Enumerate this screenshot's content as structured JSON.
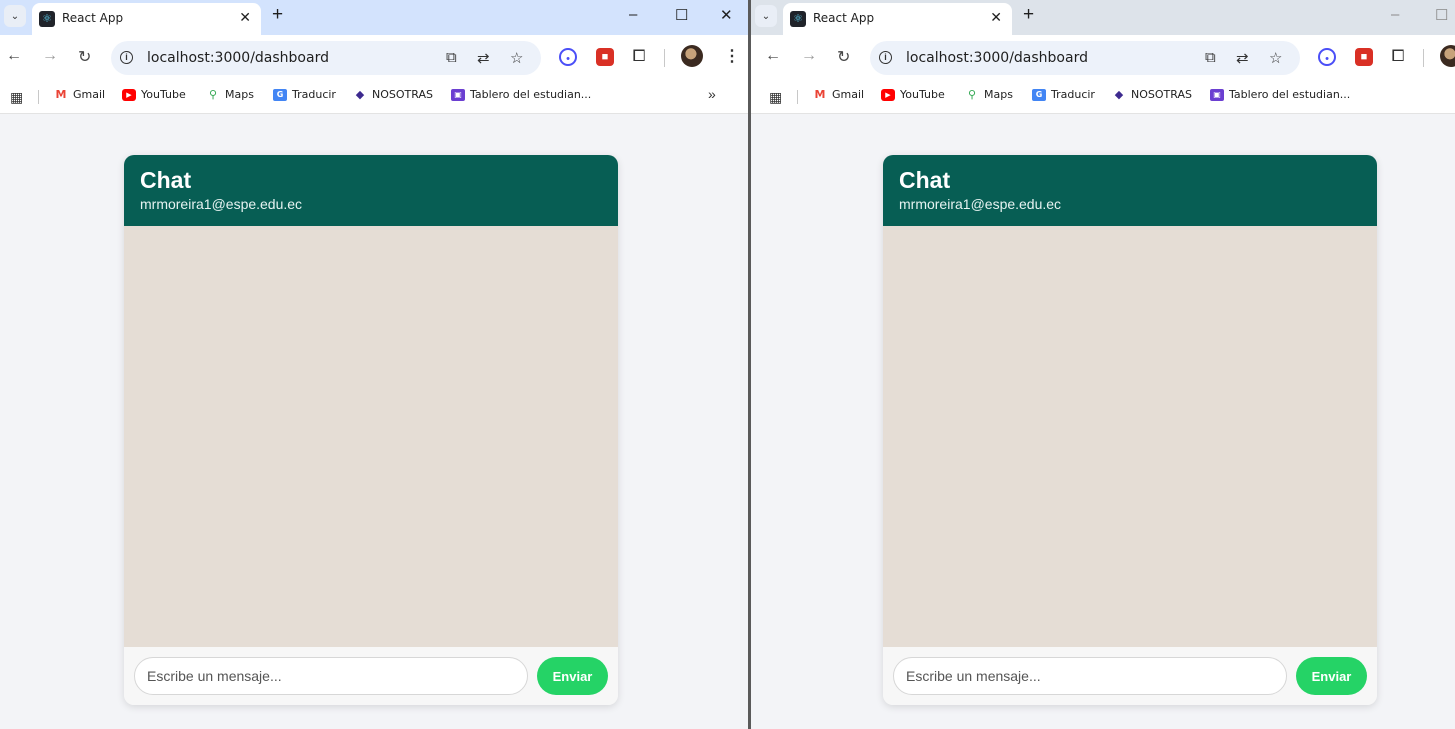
{
  "windows": [
    {
      "tab": {
        "title": "React App"
      },
      "address_bar": {
        "url": "localhost:3000/dashboard"
      },
      "bookmarks": [
        "Gmail",
        "YouTube",
        "Maps",
        "Traducir",
        "NOSOTRAS",
        "Tablero del estudian..."
      ],
      "bookmarks_more": "»",
      "chat": {
        "title": "Chat",
        "user_email": "mrmoreira1@espe.edu.ec",
        "input_placeholder": "Escribe un mensaje...",
        "send_label": "Enviar"
      }
    },
    {
      "tab": {
        "title": "React App"
      },
      "address_bar": {
        "url": "localhost:3000/dashboard"
      },
      "bookmarks": [
        "Gmail",
        "YouTube",
        "Maps",
        "Traducir",
        "NOSOTRAS",
        "Tablero del estudian..."
      ],
      "chat": {
        "title": "Chat",
        "user_email": "mrmoreira1@espe.edu.ec",
        "input_placeholder": "Escribe un mensaje...",
        "send_label": "Enviar"
      }
    }
  ],
  "colors": {
    "chat_header": "#075e54",
    "chat_body": "#e5ddd5",
    "send_button": "#25d366",
    "page_background": "#f3f4f7"
  }
}
